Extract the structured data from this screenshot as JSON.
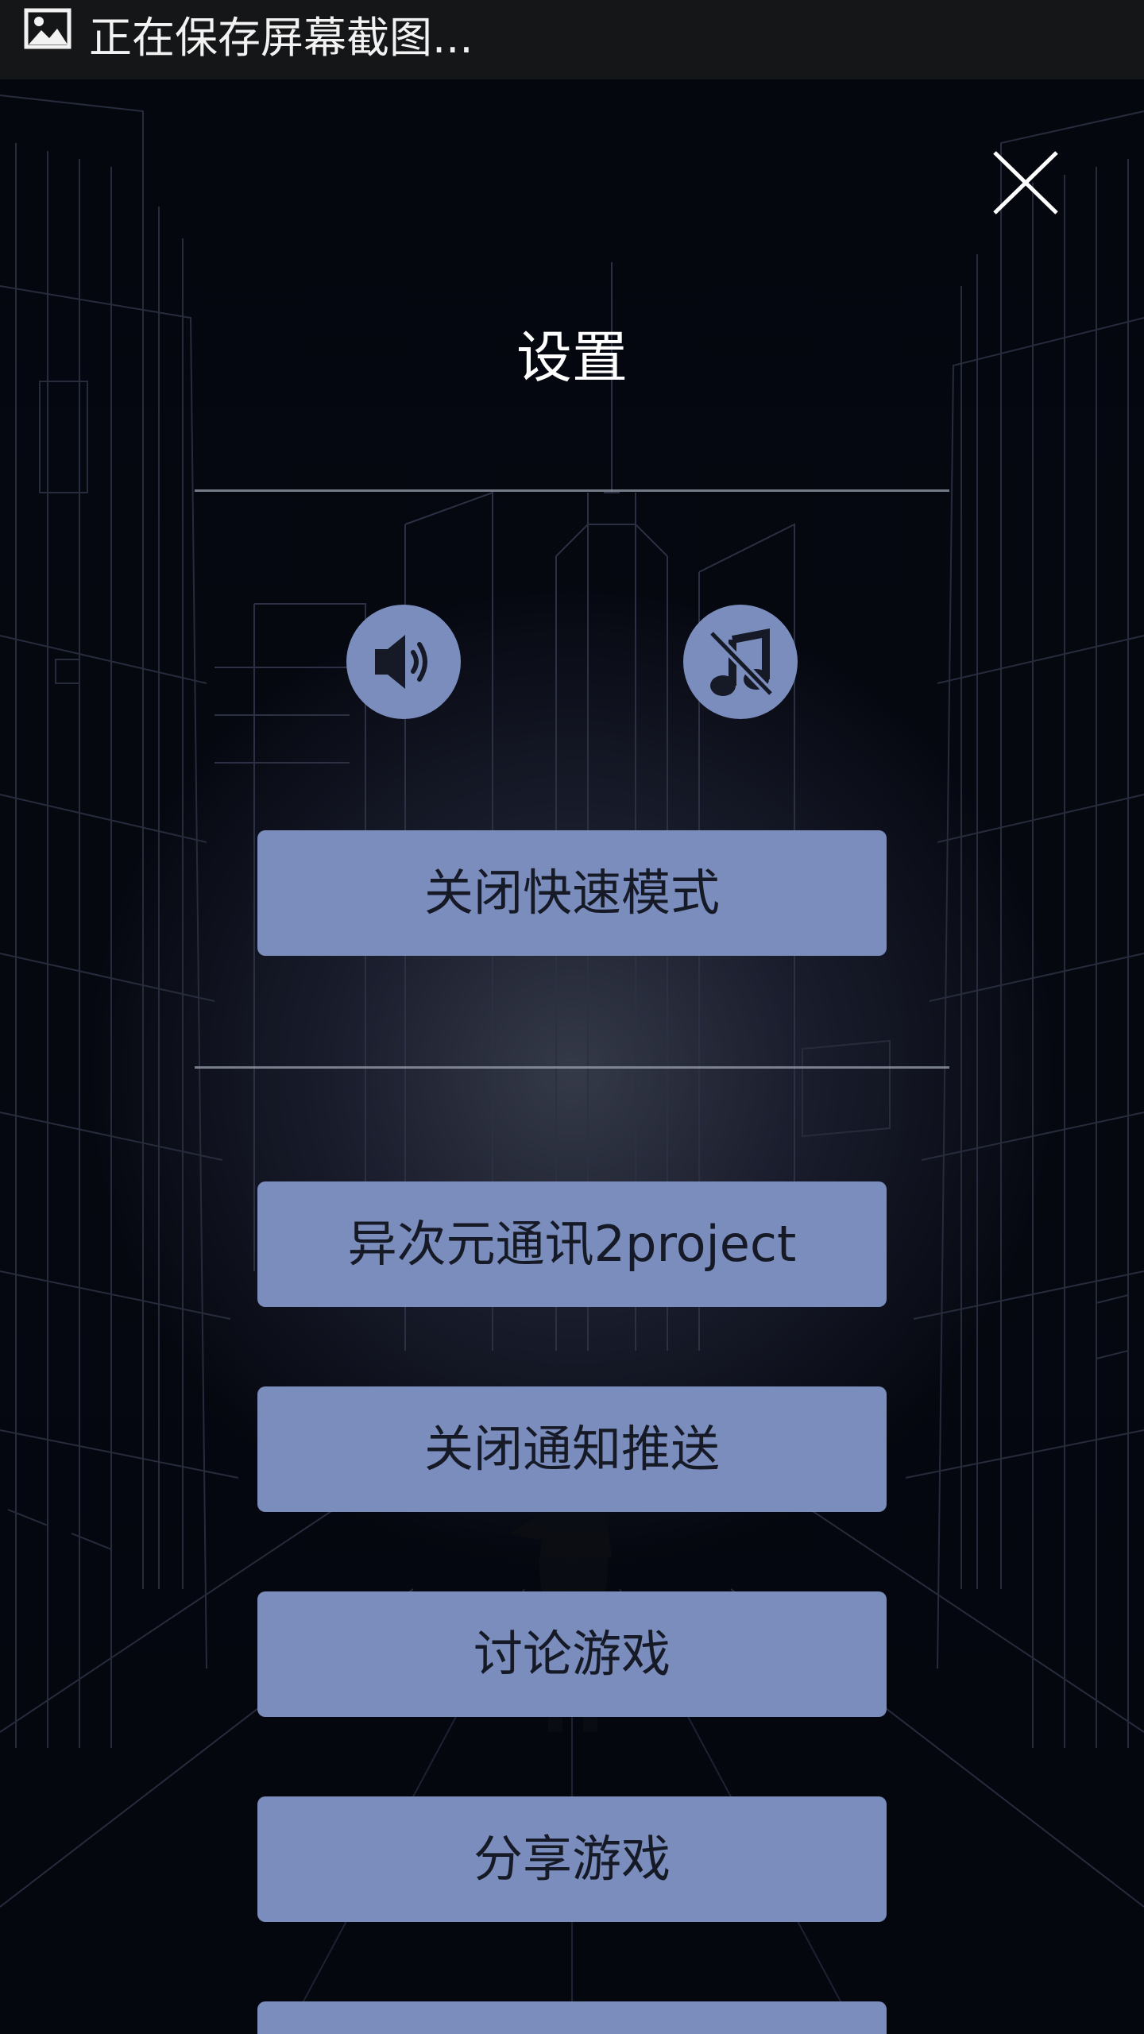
{
  "status_bar": {
    "text": "正在保存屏幕截图...",
    "icon": "image-icon"
  },
  "settings": {
    "title": "设置",
    "close_icon": "close-icon",
    "sound_icon": "speaker-icon",
    "music_icon": "music-off-icon",
    "buttons": {
      "fast_mode": "关闭快速模式",
      "project": "异次元通讯2project",
      "notification": "关闭通知推送",
      "discuss": "讨论游戏",
      "share": "分享游戏"
    }
  },
  "colors": {
    "button_fill": "#7b8dbd",
    "button_text": "#161a26",
    "background": "#05070f",
    "status_bar": "#151618",
    "title_text": "#ffffff"
  }
}
